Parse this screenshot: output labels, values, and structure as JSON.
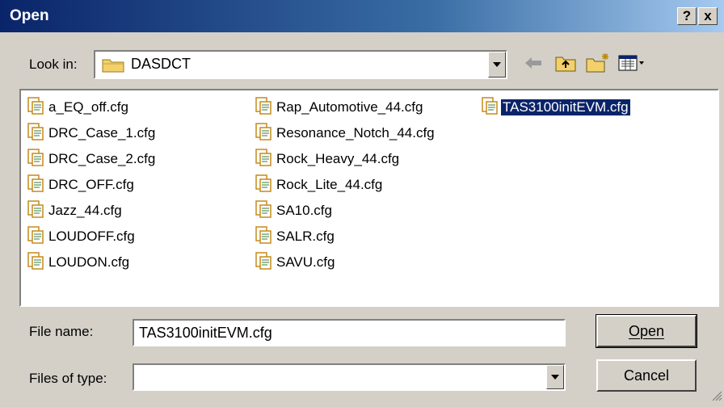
{
  "dialog": {
    "title": "Open",
    "help_button": "?",
    "close_button": "x"
  },
  "lookin": {
    "label": "Look in:",
    "folder": "DASDCT",
    "folder_icon": "folder-icon"
  },
  "toolbar": {
    "icons": [
      "back-arrow-icon",
      "up-folder-icon",
      "new-folder-icon",
      "view-menu-icon"
    ]
  },
  "files": [
    {
      "name": "a_EQ_off.cfg"
    },
    {
      "name": "DRC_Case_1.cfg"
    },
    {
      "name": "DRC_Case_2.cfg"
    },
    {
      "name": "DRC_OFF.cfg"
    },
    {
      "name": "Jazz_44.cfg"
    },
    {
      "name": "LOUDOFF.cfg"
    },
    {
      "name": "LOUDON.cfg"
    },
    {
      "name": "Rap_Automotive_44.cfg"
    },
    {
      "name": "Resonance_Notch_44.cfg"
    },
    {
      "name": "Rock_Heavy_44.cfg"
    },
    {
      "name": "Rock_Lite_44.cfg"
    },
    {
      "name": "SA10.cfg"
    },
    {
      "name": "SALR.cfg"
    },
    {
      "name": "SAVU.cfg"
    },
    {
      "name": "TAS3100initEVM.cfg",
      "selected": true
    }
  ],
  "filename": {
    "label": "File name:",
    "value": "TAS3100initEVM.cfg"
  },
  "filetype": {
    "label": "Files of type:",
    "value": ""
  },
  "buttons": {
    "open": "Open",
    "cancel": "Cancel"
  },
  "colors": {
    "title_bar": "#0a246a",
    "selection": "#0a246a",
    "dialog_bg": "#d4d0c8"
  }
}
